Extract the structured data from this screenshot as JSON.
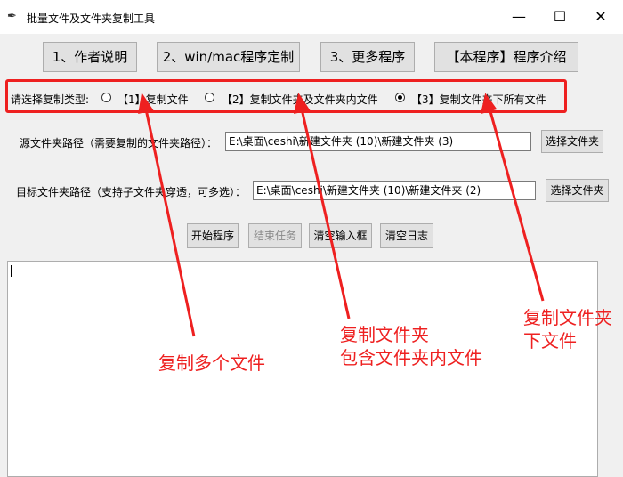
{
  "window": {
    "title": "批量文件及文件夹复制工具",
    "controls": {
      "minimize": "—",
      "maximize": "☐",
      "close": "✕"
    }
  },
  "toolbar": {
    "buttons": [
      "1、作者说明",
      "2、win/mac程序定制",
      "3、更多程序",
      "【本程序】程序介绍"
    ]
  },
  "copy_type": {
    "label": "请选择复制类型:",
    "options": [
      "【1】复制文件",
      "【2】复制文件夹及文件夹内文件",
      "【3】复制文件夹下所有文件"
    ],
    "selected_index": 2
  },
  "source": {
    "label": "源文件夹路径（需要复制的文件夹路径）：",
    "value": "E:\\桌面\\ceshi\\新建文件夹 (10)\\新建文件夹 (3)",
    "button": "选择文件夹"
  },
  "target": {
    "label": "目标文件夹路径（支持子文件夹穿透，可多选）：",
    "value": "E:\\桌面\\ceshi\\新建文件夹 (10)\\新建文件夹 (2)",
    "button": "选择文件夹"
  },
  "actions": {
    "start": "开始程序",
    "stop": "结束任务",
    "clear_input": "清空输入框",
    "clear_log": "清空日志"
  },
  "log": {
    "text": ""
  },
  "annotations": {
    "color": "#ee2020",
    "option1": "复制多个文件",
    "option2_line1": "复制文件夹",
    "option2_line2": "包含文件夹内文件",
    "option3_line1": "复制文件夹",
    "option3_line2": "下文件"
  }
}
